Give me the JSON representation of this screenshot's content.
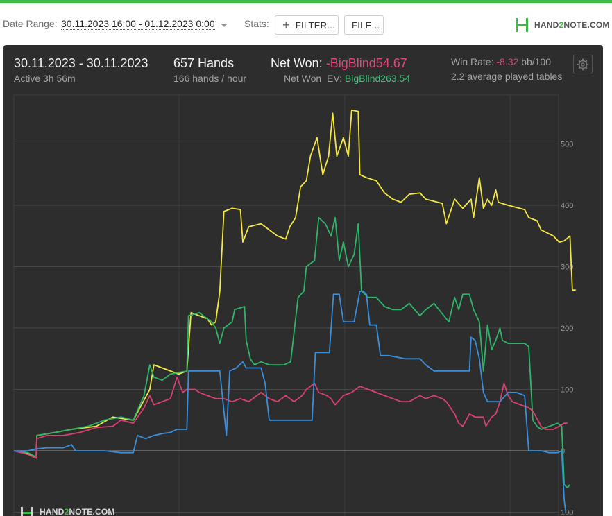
{
  "toolbar": {
    "date_range_label": "Date Range:",
    "date_range_value": "30.11.2023 16:00 - 01.12.2023 0:00",
    "stats_label": "Stats:",
    "filter_button": "FILTER...",
    "file_button": "FILE...",
    "logo": {
      "prefix": "HAND",
      "mid": "2",
      "suffix": "NOTE.COM"
    }
  },
  "summary": {
    "date_span": "30.11.2023 - 30.11.2023",
    "active": "Active 3h 56m",
    "hands": "657 Hands",
    "hands_rate": "166 hands / hour",
    "net_won_label": "Net Won:",
    "net_won_value": "-BigBlind54.67",
    "net_won_ev_label": "Net Won  EV:",
    "net_won_ev_value": "BigBlind263.54",
    "win_rate_label": "Win Rate:",
    "win_rate_value": "-8.32",
    "win_rate_unit": "bb/100",
    "avg_tables": "2.2 average played tables"
  },
  "watermark": {
    "prefix": "HAND",
    "mid": "2",
    "suffix": "NOTE.COM"
  },
  "colors": {
    "yellow": "#f5e842",
    "green": "#2fb56a",
    "blue": "#3a8fdc",
    "red": "#d9416f",
    "negative": "#e2457a",
    "positive": "#3fc27a"
  },
  "chart_data": {
    "type": "line",
    "y_ticks": [
      500,
      400,
      300,
      200,
      100,
      0,
      -100
    ],
    "y_tick_labels": [
      "500",
      "400",
      "300",
      "200",
      "100",
      "0",
      "100"
    ],
    "ylim": [
      -100,
      555
    ],
    "xlim": [
      0,
      657
    ],
    "grid": true,
    "series": [
      {
        "color": "yellow",
        "points": [
          [
            0,
            0
          ],
          [
            17,
            -5
          ],
          [
            27,
            -10
          ],
          [
            28,
            25
          ],
          [
            50,
            30
          ],
          [
            70,
            35
          ],
          [
            100,
            40
          ],
          [
            120,
            55
          ],
          [
            145,
            50
          ],
          [
            165,
            100
          ],
          [
            170,
            140
          ],
          [
            190,
            130
          ],
          [
            200,
            125
          ],
          [
            210,
            130
          ],
          [
            215,
            225
          ],
          [
            235,
            215
          ],
          [
            240,
            205
          ],
          [
            245,
            210
          ],
          [
            250,
            260
          ],
          [
            255,
            390
          ],
          [
            265,
            395
          ],
          [
            275,
            393
          ],
          [
            278,
            340
          ],
          [
            285,
            365
          ],
          [
            300,
            370
          ],
          [
            310,
            360
          ],
          [
            320,
            350
          ],
          [
            330,
            345
          ],
          [
            335,
            365
          ],
          [
            342,
            380
          ],
          [
            348,
            430
          ],
          [
            355,
            440
          ],
          [
            360,
            480
          ],
          [
            368,
            510
          ],
          [
            375,
            450
          ],
          [
            382,
            480
          ],
          [
            387,
            550
          ],
          [
            392,
            480
          ],
          [
            400,
            510
          ],
          [
            406,
            480
          ],
          [
            410,
            555
          ],
          [
            418,
            553
          ],
          [
            420,
            450
          ],
          [
            428,
            445
          ],
          [
            440,
            440
          ],
          [
            450,
            420
          ],
          [
            460,
            410
          ],
          [
            470,
            405
          ],
          [
            480,
            418
          ],
          [
            493,
            420
          ],
          [
            500,
            410
          ],
          [
            520,
            403
          ],
          [
            525,
            370
          ],
          [
            535,
            410
          ],
          [
            545,
            395
          ],
          [
            555,
            410
          ],
          [
            558,
            380
          ],
          [
            565,
            445
          ],
          [
            570,
            395
          ],
          [
            575,
            410
          ],
          [
            580,
            400
          ],
          [
            585,
            425
          ],
          [
            588,
            405
          ],
          [
            600,
            400
          ],
          [
            620,
            393
          ],
          [
            625,
            380
          ],
          [
            635,
            375
          ],
          [
            640,
            360
          ],
          [
            655,
            350
          ],
          [
            662,
            340
          ],
          [
            668,
            342
          ],
          [
            675,
            350
          ],
          [
            678,
            262
          ],
          [
            682,
            262
          ]
        ]
      },
      {
        "color": "green",
        "points": [
          [
            0,
            0
          ],
          [
            17,
            -3
          ],
          [
            27,
            -10
          ],
          [
            28,
            25
          ],
          [
            50,
            30
          ],
          [
            70,
            35
          ],
          [
            90,
            40
          ],
          [
            110,
            50
          ],
          [
            130,
            55
          ],
          [
            145,
            50
          ],
          [
            158,
            90
          ],
          [
            165,
            140
          ],
          [
            170,
            120
          ],
          [
            180,
            115
          ],
          [
            190,
            125
          ],
          [
            210,
            130
          ],
          [
            212,
            220
          ],
          [
            225,
            225
          ],
          [
            240,
            210
          ],
          [
            245,
            200
          ],
          [
            250,
            175
          ],
          [
            255,
            200
          ],
          [
            265,
            210
          ],
          [
            268,
            230
          ],
          [
            280,
            235
          ],
          [
            282,
            180
          ],
          [
            287,
            150
          ],
          [
            292,
            140
          ],
          [
            300,
            145
          ],
          [
            310,
            140
          ],
          [
            320,
            140
          ],
          [
            328,
            140
          ],
          [
            336,
            145
          ],
          [
            345,
            250
          ],
          [
            352,
            260
          ],
          [
            355,
            300
          ],
          [
            365,
            310
          ],
          [
            370,
            380
          ],
          [
            378,
            370
          ],
          [
            385,
            350
          ],
          [
            390,
            380
          ],
          [
            395,
            310
          ],
          [
            400,
            340
          ],
          [
            406,
            300
          ],
          [
            413,
            320
          ],
          [
            418,
            370
          ],
          [
            422,
            260
          ],
          [
            430,
            250
          ],
          [
            440,
            250
          ],
          [
            450,
            235
          ],
          [
            460,
            230
          ],
          [
            470,
            230
          ],
          [
            480,
            240
          ],
          [
            493,
            220
          ],
          [
            500,
            230
          ],
          [
            510,
            240
          ],
          [
            525,
            215
          ],
          [
            528,
            210
          ],
          [
            535,
            250
          ],
          [
            540,
            230
          ],
          [
            545,
            255
          ],
          [
            553,
            255
          ],
          [
            558,
            230
          ],
          [
            565,
            210
          ],
          [
            570,
            130
          ],
          [
            575,
            205
          ],
          [
            580,
            165
          ],
          [
            585,
            180
          ],
          [
            590,
            200
          ],
          [
            593,
            180
          ],
          [
            600,
            175
          ],
          [
            620,
            175
          ],
          [
            625,
            170
          ],
          [
            630,
            50
          ],
          [
            635,
            40
          ],
          [
            640,
            35
          ],
          [
            650,
            40
          ],
          [
            660,
            45
          ],
          [
            665,
            40
          ],
          [
            668,
            -55
          ],
          [
            672,
            -60
          ],
          [
            675,
            -55
          ]
        ]
      },
      {
        "color": "red",
        "points": [
          [
            0,
            0
          ],
          [
            17,
            -6
          ],
          [
            27,
            -12
          ],
          [
            28,
            20
          ],
          [
            40,
            25
          ],
          [
            60,
            25
          ],
          [
            80,
            30
          ],
          [
            100,
            38
          ],
          [
            120,
            40
          ],
          [
            130,
            50
          ],
          [
            145,
            45
          ],
          [
            158,
            70
          ],
          [
            165,
            90
          ],
          [
            170,
            75
          ],
          [
            180,
            80
          ],
          [
            190,
            85
          ],
          [
            198,
            120
          ],
          [
            205,
            95
          ],
          [
            210,
            100
          ],
          [
            220,
            100
          ],
          [
            225,
            95
          ],
          [
            235,
            90
          ],
          [
            245,
            85
          ],
          [
            255,
            85
          ],
          [
            265,
            80
          ],
          [
            275,
            85
          ],
          [
            285,
            80
          ],
          [
            300,
            95
          ],
          [
            310,
            85
          ],
          [
            320,
            80
          ],
          [
            330,
            90
          ],
          [
            340,
            80
          ],
          [
            350,
            90
          ],
          [
            355,
            100
          ],
          [
            365,
            110
          ],
          [
            370,
            95
          ],
          [
            380,
            90
          ],
          [
            385,
            85
          ],
          [
            390,
            75
          ],
          [
            400,
            90
          ],
          [
            410,
            95
          ],
          [
            420,
            105
          ],
          [
            430,
            100
          ],
          [
            440,
            95
          ],
          [
            450,
            90
          ],
          [
            460,
            85
          ],
          [
            470,
            80
          ],
          [
            480,
            80
          ],
          [
            493,
            90
          ],
          [
            500,
            85
          ],
          [
            510,
            90
          ],
          [
            520,
            85
          ],
          [
            525,
            80
          ],
          [
            535,
            60
          ],
          [
            540,
            45
          ],
          [
            545,
            40
          ],
          [
            553,
            60
          ],
          [
            560,
            55
          ],
          [
            570,
            55
          ],
          [
            573,
            40
          ],
          [
            580,
            55
          ],
          [
            585,
            60
          ],
          [
            590,
            80
          ],
          [
            595,
            110
          ],
          [
            600,
            90
          ],
          [
            605,
            80
          ],
          [
            615,
            75
          ],
          [
            625,
            70
          ],
          [
            630,
            65
          ],
          [
            640,
            40
          ],
          [
            645,
            35
          ],
          [
            655,
            35
          ],
          [
            662,
            40
          ],
          [
            668,
            45
          ],
          [
            672,
            45
          ]
        ]
      },
      {
        "color": "blue",
        "points": [
          [
            0,
            0
          ],
          [
            17,
            0
          ],
          [
            27,
            3
          ],
          [
            40,
            5
          ],
          [
            60,
            5
          ],
          [
            70,
            10
          ],
          [
            75,
            0
          ],
          [
            90,
            0
          ],
          [
            110,
            0
          ],
          [
            130,
            -3
          ],
          [
            145,
            -3
          ],
          [
            150,
            25
          ],
          [
            160,
            20
          ],
          [
            170,
            25
          ],
          [
            180,
            28
          ],
          [
            190,
            30
          ],
          [
            198,
            35
          ],
          [
            210,
            35
          ],
          [
            212,
            130
          ],
          [
            230,
            130
          ],
          [
            250,
            130
          ],
          [
            258,
            25
          ],
          [
            262,
            130
          ],
          [
            270,
            135
          ],
          [
            278,
            145
          ],
          [
            282,
            135
          ],
          [
            300,
            135
          ],
          [
            305,
            110
          ],
          [
            310,
            50
          ],
          [
            325,
            50
          ],
          [
            340,
            50
          ],
          [
            350,
            50
          ],
          [
            362,
            50
          ],
          [
            366,
            160
          ],
          [
            373,
            160
          ],
          [
            383,
            160
          ],
          [
            388,
            255
          ],
          [
            395,
            255
          ],
          [
            400,
            210
          ],
          [
            406,
            210
          ],
          [
            413,
            210
          ],
          [
            420,
            260
          ],
          [
            424,
            260
          ],
          [
            428,
            255
          ],
          [
            432,
            205
          ],
          [
            440,
            205
          ],
          [
            445,
            155
          ],
          [
            455,
            155
          ],
          [
            475,
            150
          ],
          [
            493,
            150
          ],
          [
            500,
            140
          ],
          [
            510,
            130
          ],
          [
            530,
            130
          ],
          [
            545,
            130
          ],
          [
            553,
            130
          ],
          [
            555,
            185
          ],
          [
            560,
            180
          ],
          [
            565,
            150
          ],
          [
            570,
            95
          ],
          [
            575,
            80
          ],
          [
            580,
            80
          ],
          [
            590,
            80
          ],
          [
            600,
            95
          ],
          [
            605,
            95
          ],
          [
            610,
            95
          ],
          [
            620,
            90
          ],
          [
            625,
            0
          ],
          [
            630,
            0
          ],
          [
            640,
            0
          ],
          [
            650,
            -3
          ],
          [
            660,
            -3
          ],
          [
            665,
            0
          ],
          [
            668,
            -80
          ],
          [
            670,
            -100
          ]
        ]
      }
    ]
  }
}
